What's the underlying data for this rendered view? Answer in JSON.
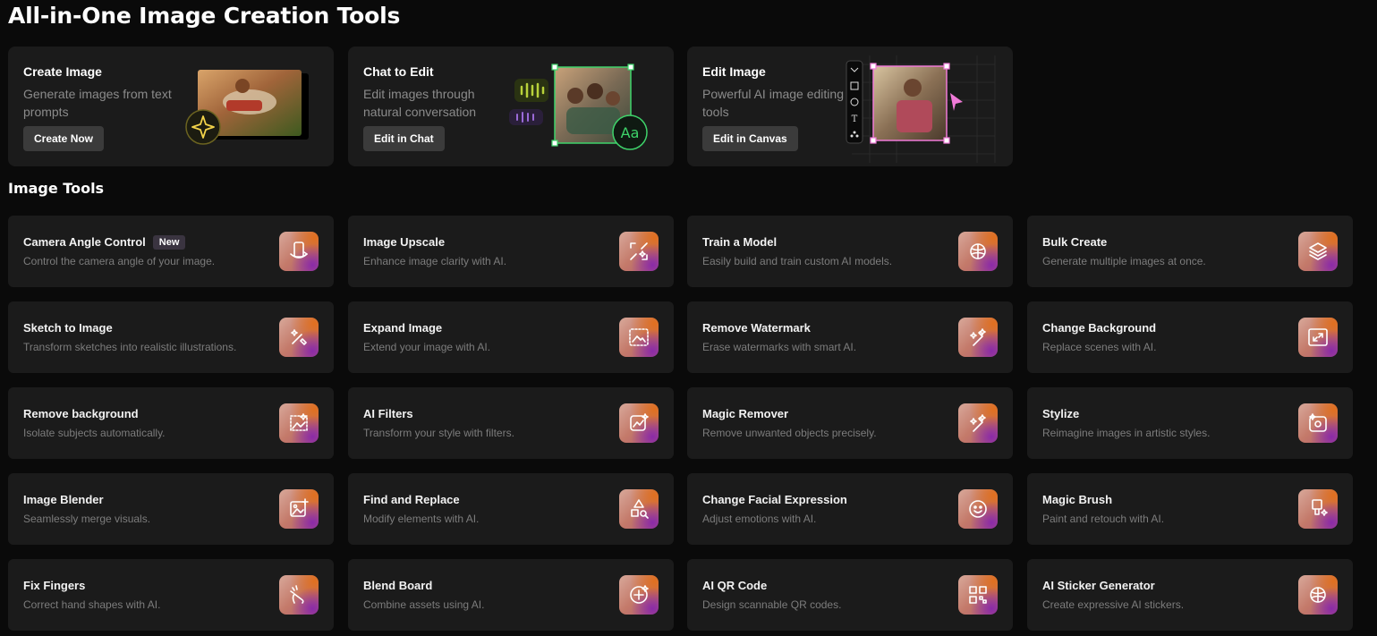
{
  "page_title": "All-in-One Image Creation Tools",
  "features": [
    {
      "title": "Create Image",
      "desc": "Generate images from text prompts",
      "button": "Create Now"
    },
    {
      "title": "Chat to Edit",
      "desc": "Edit images through natural conversation",
      "button": "Edit in Chat",
      "badge_text": "Aa"
    },
    {
      "title": "Edit Image",
      "desc": "Powerful AI image editing tools",
      "button": "Edit in Canvas",
      "toolbar_text": "T"
    }
  ],
  "section_title": "Image Tools",
  "tools": [
    {
      "title": "Camera Angle Control",
      "badge": "New",
      "desc": "Control the camera angle of your image.",
      "icon": "camera-rotate-icon"
    },
    {
      "title": "Image Upscale",
      "desc": "Enhance image clarity with AI.",
      "icon": "upscale-icon"
    },
    {
      "title": "Train a Model",
      "desc": "Easily build and train custom AI models.",
      "icon": "brain-icon"
    },
    {
      "title": "Bulk Create",
      "desc": "Generate multiple images at once.",
      "icon": "layers-icon"
    },
    {
      "title": "Sketch to Image",
      "desc": "Transform sketches into realistic illustrations.",
      "icon": "sketch-wand-icon"
    },
    {
      "title": "Expand Image",
      "desc": "Extend your image with AI.",
      "icon": "expand-image-icon"
    },
    {
      "title": "Remove Watermark",
      "desc": "Erase watermarks with smart AI.",
      "icon": "eraser-sparkle-icon"
    },
    {
      "title": "Change Background",
      "desc": "Replace scenes with AI.",
      "icon": "background-swap-icon"
    },
    {
      "title": "Remove background",
      "desc": "Isolate subjects automatically.",
      "icon": "remove-bg-icon"
    },
    {
      "title": "AI Filters",
      "desc": "Transform your style with filters.",
      "icon": "filter-chart-icon"
    },
    {
      "title": "Magic Remover",
      "desc": "Remove unwanted objects precisely.",
      "icon": "magic-eraser-icon"
    },
    {
      "title": "Stylize",
      "desc": "Reimagine images in artistic styles.",
      "icon": "stylize-icon"
    },
    {
      "title": "Image Blender",
      "desc": "Seamlessly merge visuals.",
      "icon": "image-add-icon"
    },
    {
      "title": "Find and Replace",
      "desc": "Modify elements with AI.",
      "icon": "shapes-search-icon"
    },
    {
      "title": "Change Facial Expression",
      "desc": "Adjust emotions with AI.",
      "icon": "smile-icon"
    },
    {
      "title": "Magic Brush",
      "desc": "Paint and retouch with AI.",
      "icon": "brush-sparkle-icon"
    },
    {
      "title": "Fix Fingers",
      "desc": "Correct hand shapes with AI.",
      "icon": "hand-fix-icon"
    },
    {
      "title": "Blend Board",
      "desc": "Combine assets using AI.",
      "icon": "blend-plus-icon"
    },
    {
      "title": "AI QR Code",
      "desc": "Design scannable QR codes.",
      "icon": "qr-code-icon"
    },
    {
      "title": "AI Sticker Generator",
      "desc": "Create expressive AI stickers.",
      "icon": "sticker-icon"
    }
  ]
}
